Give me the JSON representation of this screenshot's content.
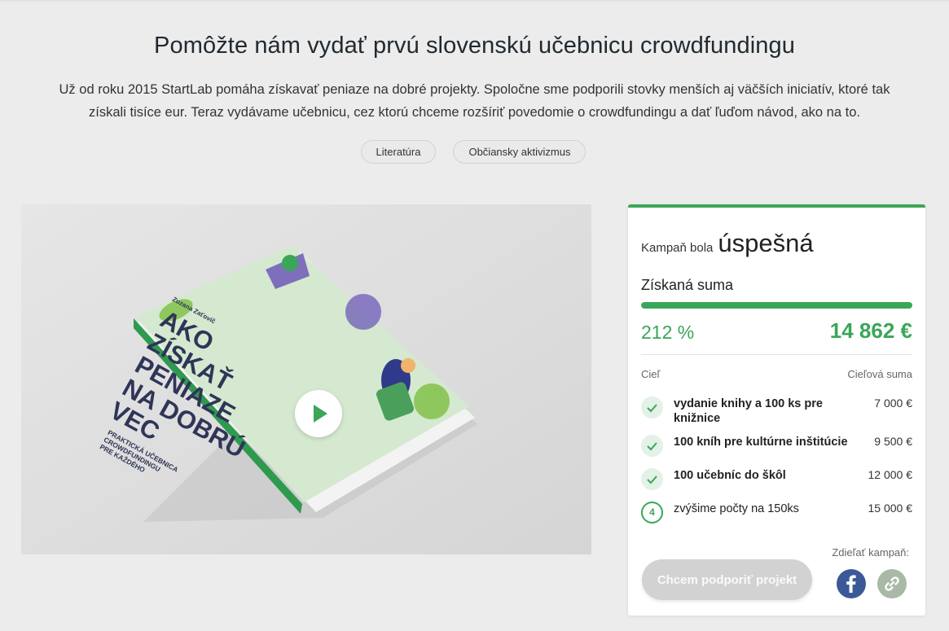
{
  "header": {
    "title": "Pomôžte nám vydať prvú slovenskú učebnicu crowdfundingu",
    "description": "Už od roku 2015 StartLab pomáha získavať peniaze na dobré projekty. Spoločne sme podporili stovky menších aj väčších iniciatív, ktoré tak získali tisíce eur. Teraz vydávame učebnicu, cez ktorú chceme rozšíriť povedomie o crowdfundingu a dať ľuďom návod, ako na to.",
    "tags": [
      "Literatúra",
      "Občiansky aktivizmus"
    ]
  },
  "video": {
    "book_author": "Zuzana Zaťovič",
    "book_title_lines": [
      "AKO",
      "ZÍSKAŤ",
      "PENIAZE",
      "NA DOBRÚ",
      "VEC"
    ],
    "book_subtitle_lines": [
      "PRAKTICKÁ UČEBNICA",
      "CROWDFUNDINGU",
      "PRE KAŽDÉHO"
    ],
    "play_icon": "play-icon"
  },
  "campaign": {
    "status_prefix": "Kampaň bola",
    "status_word": "úspešná",
    "raised_label": "Získaná suma",
    "progress_fraction": 1.0,
    "percent": "212 %",
    "amount": "14 862 €",
    "col_goal": "Cieľ",
    "col_target": "Cieľová suma",
    "goals": [
      {
        "text": "vydanie knihy a 100 ks pre knižnice",
        "value": "7 000 €",
        "done": true,
        "icon": "check-icon"
      },
      {
        "text": "100 kníh pre kultúrne inštitúcie",
        "value": "9 500 €",
        "done": true,
        "icon": "check-icon"
      },
      {
        "text": "100 učebníc do škôl",
        "value": "12 000 €",
        "done": true,
        "icon": "check-icon"
      },
      {
        "text": "zvýšime počty na 150ks",
        "value": "15 000 €",
        "done": false,
        "number": "4"
      }
    ],
    "share_label": "Zdieľať kampaň:",
    "support_button": "Chcem podporiť projekt",
    "share_icons": [
      "facebook-icon",
      "link-icon"
    ]
  },
  "colors": {
    "accent": "#3aa658",
    "facebook": "#3b5998",
    "book_cover": "#d4e9cf"
  }
}
